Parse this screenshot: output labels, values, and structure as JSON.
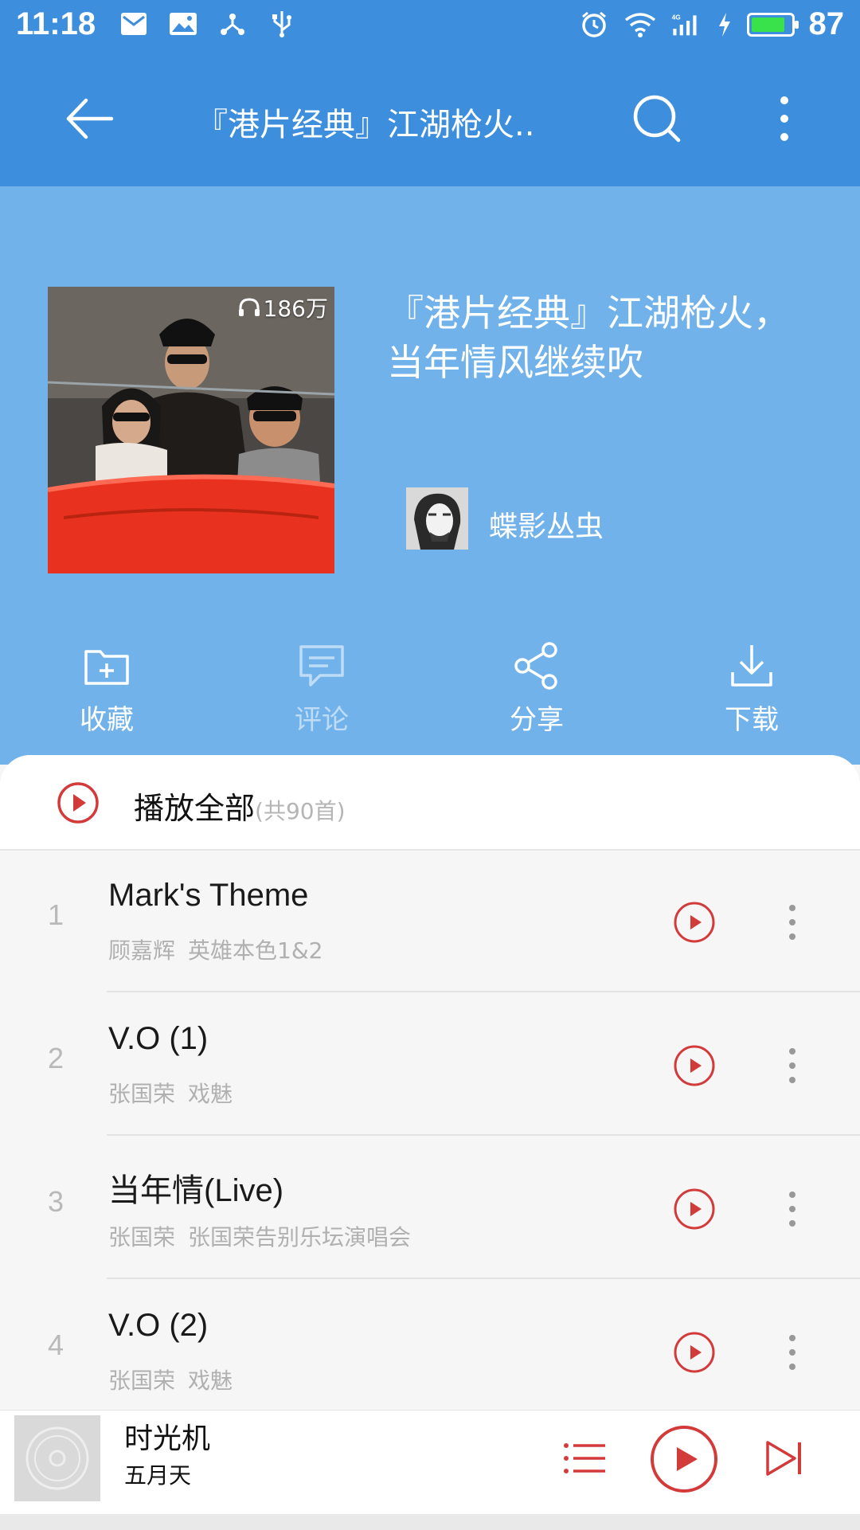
{
  "status_bar": {
    "time": "11:18",
    "battery_percent": "87",
    "battery_level": 0.87,
    "network": "4G",
    "icons": [
      "mail-icon",
      "image-icon",
      "share-icon",
      "usb-icon",
      "alarm-icon",
      "wifi-icon",
      "signal-icon",
      "charging-icon",
      "battery-icon"
    ]
  },
  "app_bar": {
    "title": "『港片经典』江湖枪火..",
    "back_icon": "arrow-left-icon",
    "search_icon": "search-icon",
    "more_icon": "more-vertical-icon"
  },
  "playlist": {
    "title_line1": "『港片经典』江湖枪火，",
    "title_line2": "当年情风继续吹",
    "play_count": "186万",
    "creator": "蝶影丛虫"
  },
  "actions": [
    {
      "label": "收藏",
      "icon": "folder-plus-icon",
      "enabled": true
    },
    {
      "label": "评论",
      "icon": "comment-icon",
      "enabled": false
    },
    {
      "label": "分享",
      "icon": "share-icon",
      "enabled": true
    },
    {
      "label": "下载",
      "icon": "download-icon",
      "enabled": true
    }
  ],
  "play_all": {
    "label": "播放全部",
    "count": "(共90首)"
  },
  "tracks": [
    {
      "number": "1",
      "title": "Mark's Theme",
      "artist": "顾嘉辉",
      "album": "英雄本色1&2"
    },
    {
      "number": "2",
      "title": "V.O (1)",
      "artist": "张国荣",
      "album": "戏魅"
    },
    {
      "number": "3",
      "title": "当年情(Live)",
      "artist": "张国荣",
      "album": "张国荣告别乐坛演唱会"
    },
    {
      "number": "4",
      "title": "V.O (2)",
      "artist": "张国荣",
      "album": "戏魅"
    }
  ],
  "mini_player": {
    "song": "时光机",
    "artist": "五月天"
  },
  "colors": {
    "primary": "#3d8fde",
    "header_bg": "#72b2ea",
    "accent_red": "#d33b3b"
  }
}
